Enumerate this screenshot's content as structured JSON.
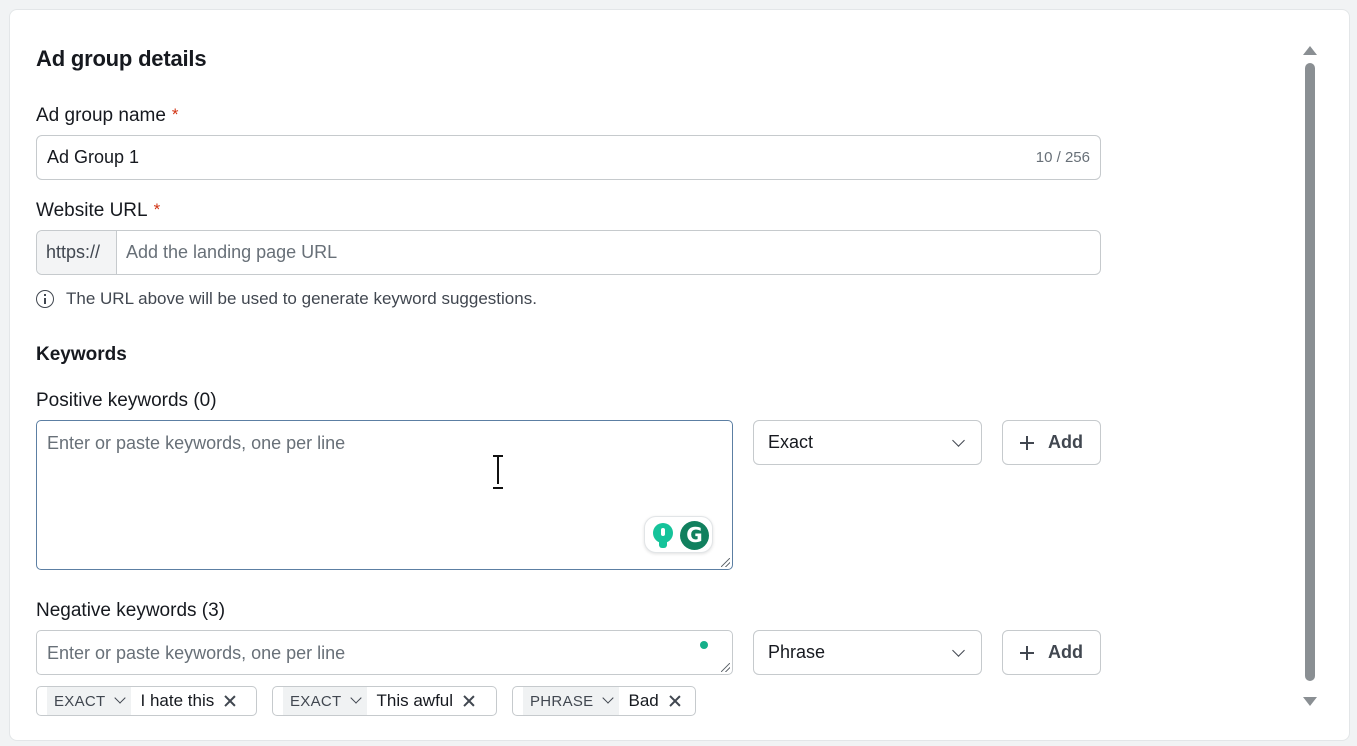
{
  "section": {
    "title": "Ad group details"
  },
  "ad_group_name": {
    "label": "Ad group name",
    "required_marker": "*",
    "value": "Ad Group 1",
    "counter": "10 / 256"
  },
  "website_url": {
    "label": "Website URL",
    "required_marker": "*",
    "prefix": "https://",
    "placeholder": "Add the landing page URL",
    "hint": "The URL above will be used to generate keyword suggestions."
  },
  "keywords": {
    "heading": "Keywords",
    "positive": {
      "label": "Positive keywords (0)",
      "placeholder": "Enter or paste keywords, one per line",
      "match_type": "Exact",
      "add_label": "Add"
    },
    "negative": {
      "label": "Negative keywords (3)",
      "placeholder": "Enter or paste keywords, one per line",
      "match_type": "Phrase",
      "add_label": "Add",
      "tags": [
        {
          "type": "EXACT",
          "text": "I hate this"
        },
        {
          "type": "EXACT",
          "text": "This awful"
        },
        {
          "type": "PHRASE",
          "text": "Bad"
        }
      ]
    }
  },
  "grammarly": {
    "logo_letter": "G"
  },
  "icons": {
    "info": "info-icon",
    "chevron": "chevron-down-icon",
    "plus": "plus-icon",
    "remove": "close-icon",
    "grammarly": "grammarly-icon",
    "bulb": "lightbulb-icon"
  },
  "colors": {
    "required": "#d13212",
    "focus_border": "#5c7fa3",
    "grammarly_green": "#15c39a"
  }
}
